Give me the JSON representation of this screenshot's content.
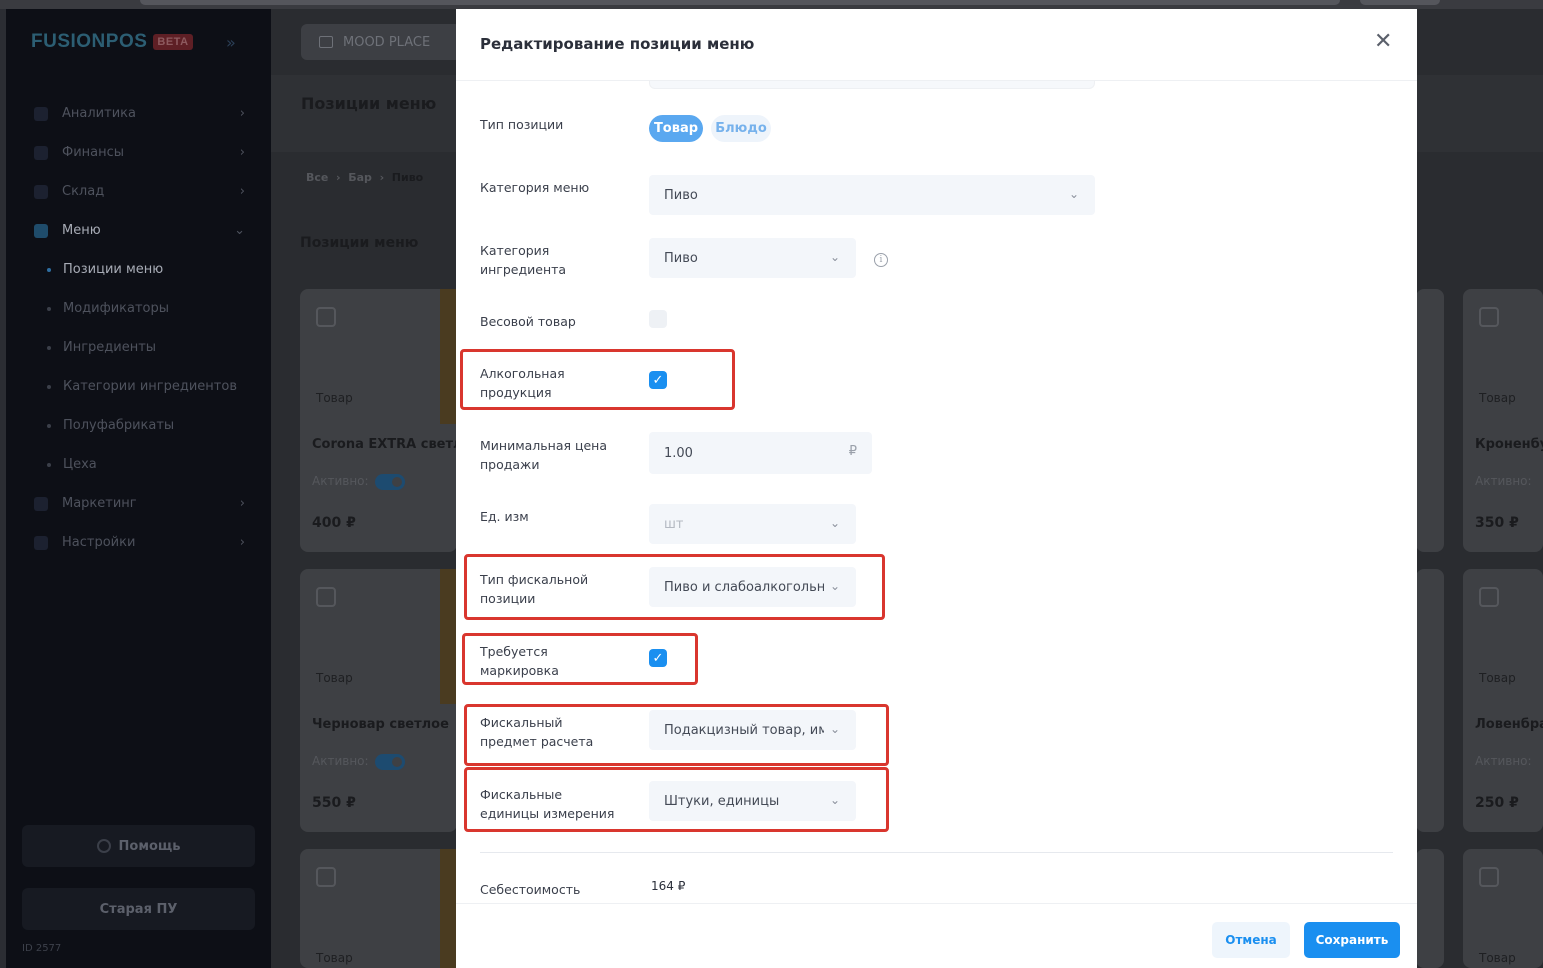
{
  "app": {
    "logo": "FUSIONPOS",
    "badge": "BETA",
    "place": "MOOD PLACE",
    "id_text": "ID 2577"
  },
  "sidebar": {
    "items": [
      {
        "label": "Аналитика",
        "icon": "chart-icon"
      },
      {
        "label": "Финансы",
        "icon": "wallet-icon"
      },
      {
        "label": "Склад",
        "icon": "box-icon"
      },
      {
        "label": "Меню",
        "icon": "book-icon"
      }
    ],
    "sub_items": [
      {
        "label": "Позиции меню"
      },
      {
        "label": "Модификаторы"
      },
      {
        "label": "Ингредиенты"
      },
      {
        "label": "Категории ингредиентов"
      },
      {
        "label": "Полуфабрикаты"
      },
      {
        "label": "Цеха"
      }
    ],
    "items_after": [
      {
        "label": "Маркетинг",
        "icon": "megaphone-icon"
      },
      {
        "label": "Настройки",
        "icon": "gear-icon"
      }
    ],
    "help_label": "Помощь",
    "old_label": "Старая ПУ"
  },
  "background": {
    "page_title": "Позиции меню",
    "breadcrumb": [
      "Все",
      "Бар",
      "Пиво"
    ],
    "section_title": "Позиции меню",
    "cards": [
      {
        "tag": "Товар",
        "name": "Corona EXTRA светлое",
        "active_label": "Активно:",
        "price": "400 ₽"
      },
      {
        "tag": "Товар",
        "name": "Черновар светлое",
        "active_label": "Активно:",
        "price": "550 ₽"
      },
      {
        "tag": "Товар"
      }
    ],
    "cards_right": [
      {
        "tag": "Товар",
        "name": "Кроненбург",
        "active_label": "Активно:",
        "price": "350 ₽"
      },
      {
        "tag": "Товар",
        "name": "Ловенбрау",
        "active_label": "Активно:",
        "price": "250 ₽"
      },
      {
        "tag": "Товар"
      }
    ]
  },
  "modal": {
    "title": "Редактирование позиции меню",
    "position_type": {
      "label": "Тип позиции",
      "options": [
        "Товар",
        "Блюдо"
      ],
      "selected": "Товар"
    },
    "menu_category": {
      "label": "Категория меню",
      "value": "Пиво"
    },
    "ingredient_category": {
      "label": "Категория ингредиента",
      "value": "Пиво"
    },
    "weighted": {
      "label": "Весовой товар",
      "checked": false
    },
    "alcohol": {
      "label": "Алкогольная продукция",
      "checked": true
    },
    "min_price": {
      "label": "Минимальная цена продажи",
      "value": "1.00",
      "currency": "₽"
    },
    "unit": {
      "label": "Ед. изм",
      "value": "шт"
    },
    "fiscal_type": {
      "label": "Тип фискальной позиции",
      "value": "Пиво и слабоалкогольн"
    },
    "marking": {
      "label": "Требуется маркировка",
      "checked": true
    },
    "fiscal_subject": {
      "label": "Фискальный предмет расчета",
      "value": "Подакцизный товар, им"
    },
    "fiscal_units": {
      "label": "Фискальные единицы измерения",
      "value": "Штуки, единицы"
    },
    "cost": {
      "label": "Себестоимость",
      "value": "164 ₽"
    },
    "cancel_label": "Отмена",
    "save_label": "Сохранить"
  },
  "colors": {
    "accent": "#1a8ff0",
    "highlight": "#d9362e"
  }
}
